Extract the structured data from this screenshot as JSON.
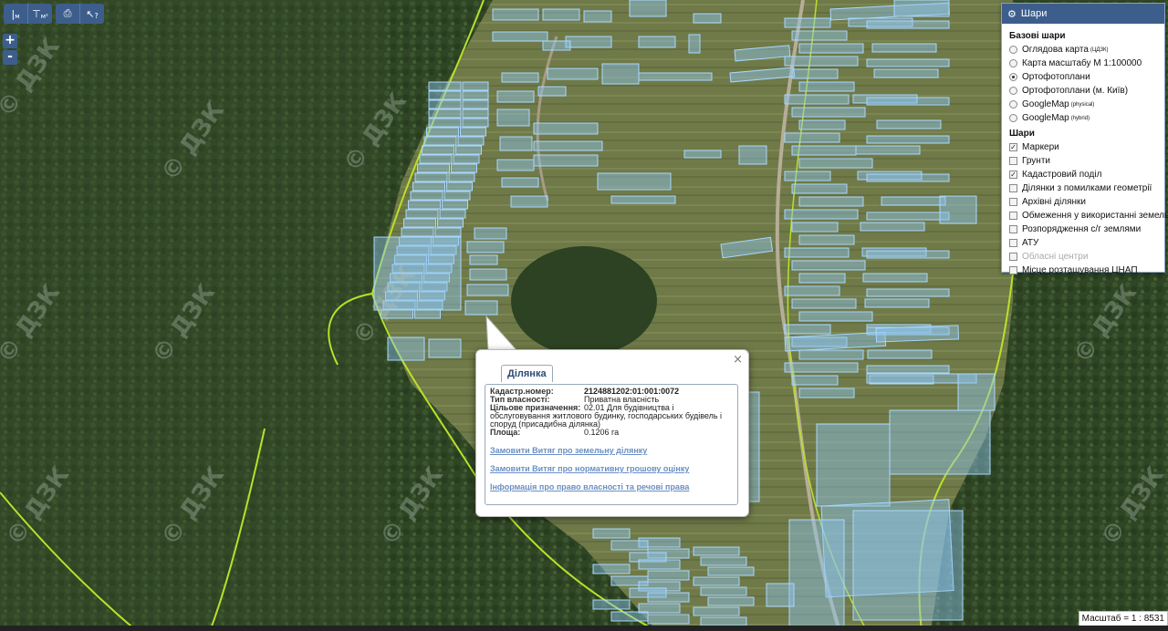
{
  "toolbar": {
    "measure_distance": "м",
    "measure_area": "м²",
    "print": "print-icon",
    "info": "?"
  },
  "zoom": {
    "in": "+",
    "out": "-"
  },
  "layers_panel": {
    "title": "Шари",
    "base_title": "Базові шари",
    "base_layers": [
      {
        "label": "Оглядова карта",
        "sup": "(ЦДЗК)",
        "selected": false
      },
      {
        "label": "Карта масштабу М 1:100000",
        "sup": "",
        "selected": false
      },
      {
        "label": "Ортофотоплани",
        "sup": "",
        "selected": true
      },
      {
        "label": "Ортофотоплани (м. Київ)",
        "sup": "",
        "selected": false
      },
      {
        "label": "GoogleMap",
        "sup": "(physical)",
        "selected": false
      },
      {
        "label": "GoogleMap",
        "sup": "(hybrid)",
        "selected": false
      }
    ],
    "overlays_title": "Шари",
    "overlays": [
      {
        "label": "Маркери",
        "checked": true,
        "disabled": false
      },
      {
        "label": "Грунти",
        "checked": false,
        "disabled": false
      },
      {
        "label": "Кадастровий поділ",
        "checked": true,
        "disabled": false
      },
      {
        "label": "Ділянки з помилками геометрії",
        "checked": false,
        "disabled": false
      },
      {
        "label": "Архівні ділянки",
        "checked": false,
        "disabled": false
      },
      {
        "label": "Обмеження у використанні земель",
        "checked": false,
        "disabled": false
      },
      {
        "label": "Розпорядження с/г землями",
        "checked": false,
        "disabled": false
      },
      {
        "label": "АТУ",
        "checked": false,
        "disabled": false
      },
      {
        "label": "Обласні центри",
        "checked": false,
        "disabled": true
      },
      {
        "label": "Місце розташування ЦНАП",
        "checked": false,
        "disabled": false
      }
    ]
  },
  "popup": {
    "tab": "Ділянка",
    "close": "×",
    "fields": [
      {
        "key": "Кадастр.номер:",
        "value": "2124881202:01:001:0072"
      },
      {
        "key": "Тип власності:",
        "value": "Приватна власність"
      }
    ],
    "purpose_key": "Цільове призначення:",
    "purpose_line1": "02.01 Для будівництва і",
    "purpose_rest": "обслуговування житлового будинку, господарських будівель і споруд (присадибна ділянка)",
    "area_key": "Площа:",
    "area_value": "0.1206 га",
    "links": [
      "Замовити Витяг про земельну ділянку",
      "Замовити Витяг про нормативну грошову оцінку",
      "Інформація про право власності та речові права"
    ]
  },
  "watermark": "© ДЗК",
  "scale": "Масштаб = 1 : 8531",
  "colors": {
    "panel_header": "#3d5e8c",
    "parcel_fill": "#8ec5f0",
    "boundary": "#b9e12a",
    "link": "#6a8fc4"
  }
}
